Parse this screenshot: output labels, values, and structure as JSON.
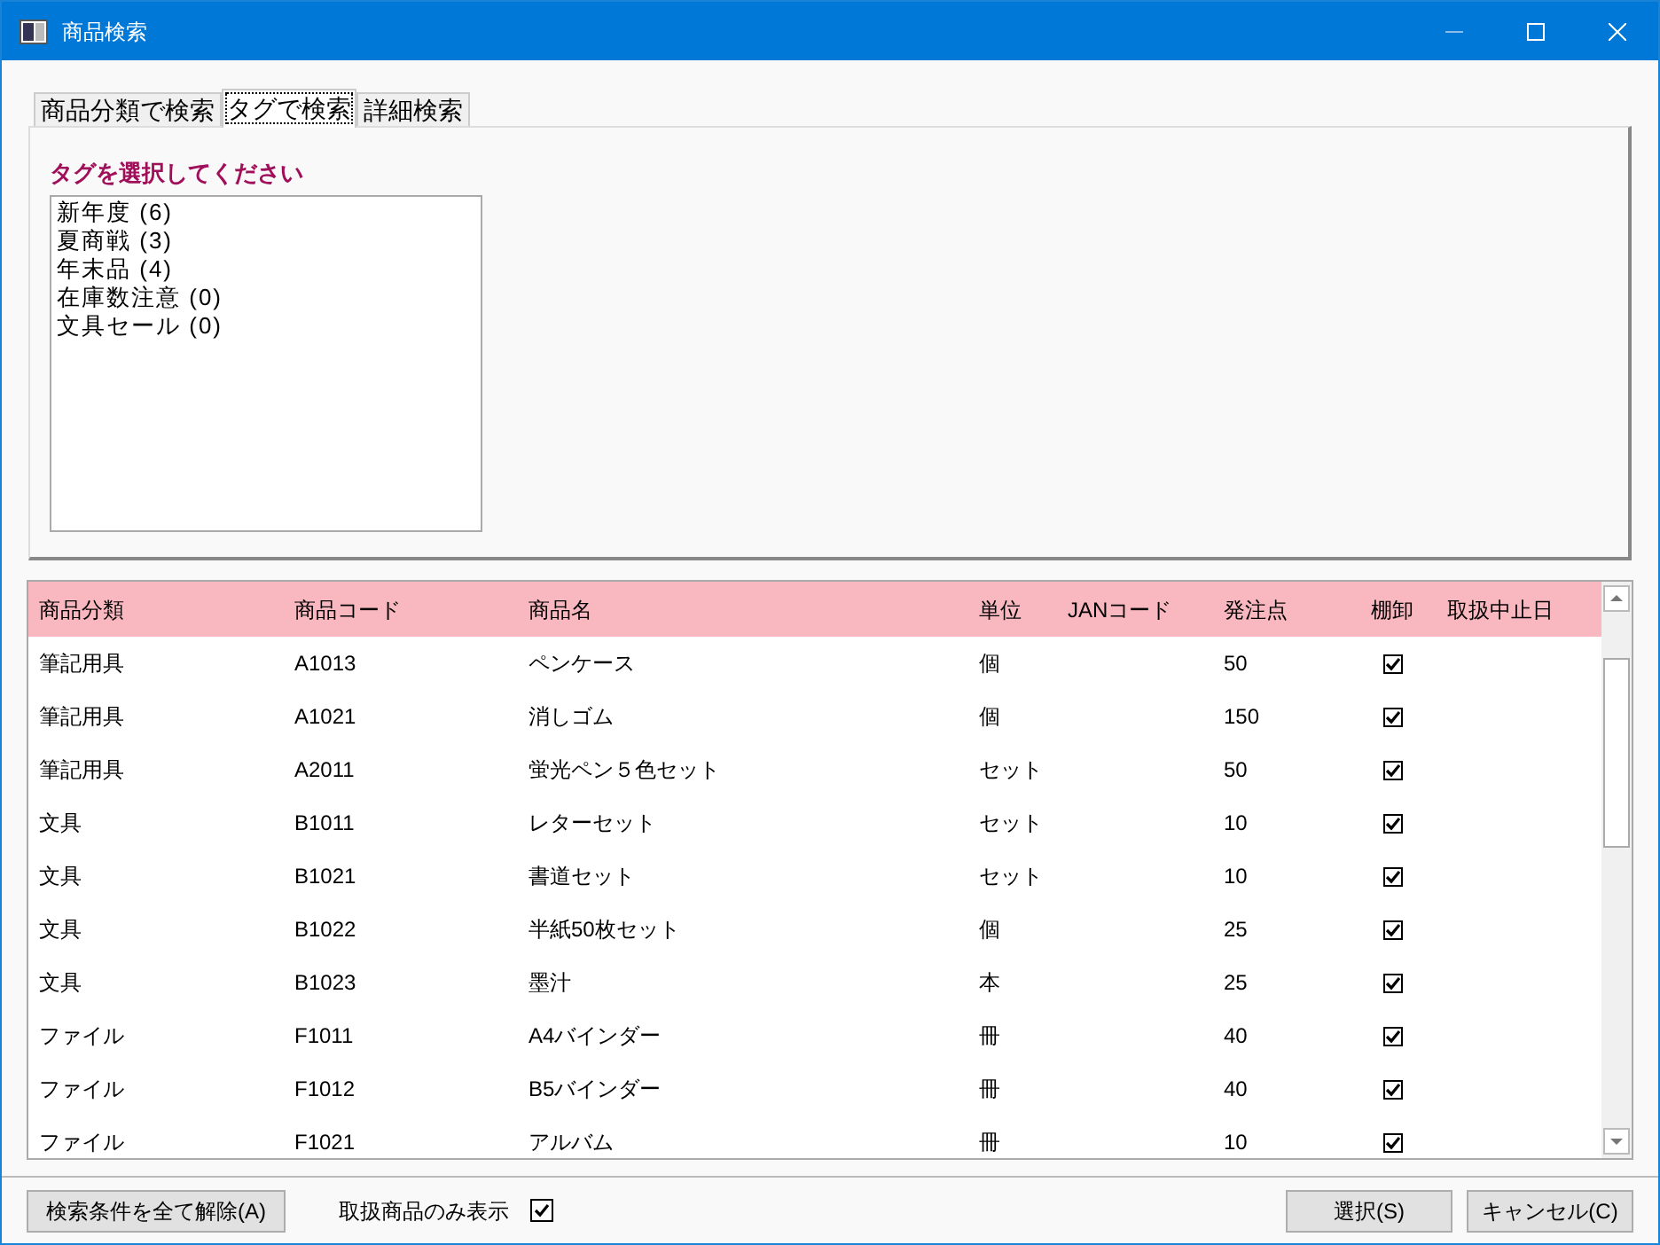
{
  "window": {
    "title": "商品検索"
  },
  "tabs": [
    {
      "label": "商品分類で検索",
      "selected": false
    },
    {
      "label": "タグで検索",
      "selected": true
    },
    {
      "label": "詳細検索",
      "selected": false
    }
  ],
  "tag_panel": {
    "heading": "タグを選択してください",
    "tags": [
      "新年度 (6)",
      "夏商戦 (3)",
      "年末品 (4)",
      "在庫数注意 (0)",
      "文具セール (0)"
    ]
  },
  "table": {
    "columns": [
      "商品分類",
      "商品コード",
      "商品名",
      "単位",
      "JANコード",
      "発注点",
      "棚卸",
      "取扱中止日"
    ],
    "rows": [
      {
        "category": "筆記用具",
        "code": "A1013",
        "name": "ペンケース",
        "unit": "個",
        "reorder": "50",
        "inventory": true
      },
      {
        "category": "筆記用具",
        "code": "A1021",
        "name": "消しゴム",
        "unit": "個",
        "reorder": "150",
        "inventory": true
      },
      {
        "category": "筆記用具",
        "code": "A2011",
        "name": "蛍光ペン５色セット",
        "unit": "セット",
        "reorder": "50",
        "inventory": true
      },
      {
        "category": "文具",
        "code": "B1011",
        "name": "レターセット",
        "unit": "セット",
        "reorder": "10",
        "inventory": true
      },
      {
        "category": "文具",
        "code": "B1021",
        "name": "書道セット",
        "unit": "セット",
        "reorder": "10",
        "inventory": true
      },
      {
        "category": "文具",
        "code": "B1022",
        "name": "半紙50枚セット",
        "unit": "個",
        "reorder": "25",
        "inventory": true
      },
      {
        "category": "文具",
        "code": "B1023",
        "name": "墨汁",
        "unit": "本",
        "reorder": "25",
        "inventory": true
      },
      {
        "category": "ファイル",
        "code": "F1011",
        "name": "A4バインダー",
        "unit": "冊",
        "reorder": "40",
        "inventory": true
      },
      {
        "category": "ファイル",
        "code": "F1012",
        "name": "B5バインダー",
        "unit": "冊",
        "reorder": "40",
        "inventory": true
      },
      {
        "category": "ファイル",
        "code": "F1021",
        "name": "アルバム",
        "unit": "冊",
        "reorder": "10",
        "inventory": true
      }
    ]
  },
  "footer": {
    "clear_button": "検索条件を全て解除(A)",
    "active_only": {
      "label": "取扱商品のみ表示",
      "checked": true
    },
    "select_button": "選択(S)",
    "cancel_button": "キャンセル(C)"
  }
}
